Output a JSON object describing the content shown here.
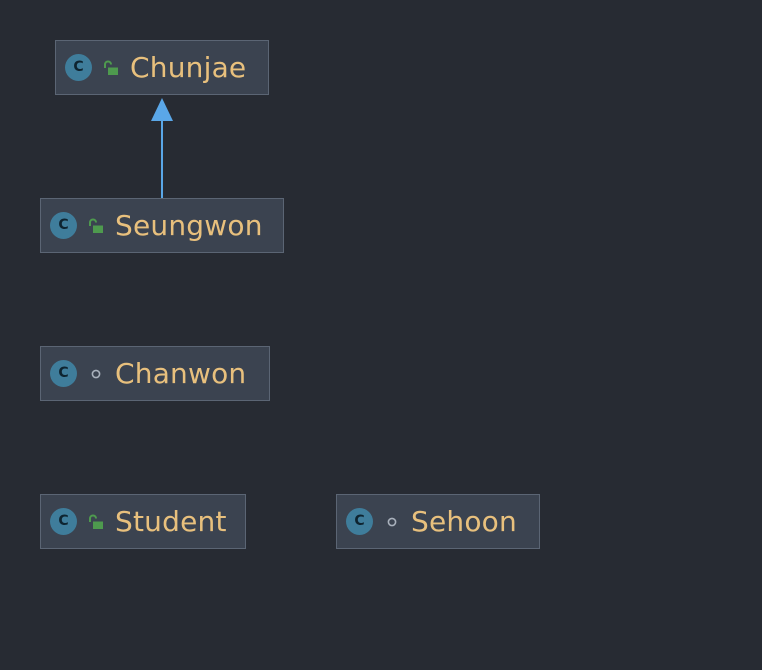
{
  "diagram": {
    "classes": [
      {
        "id": "chunjae",
        "kind_icon": "class-icon",
        "kind_letter": "C",
        "visibility_icon": "public-lock-icon",
        "name": "Chunjae"
      },
      {
        "id": "seungwon",
        "kind_icon": "class-icon",
        "kind_letter": "C",
        "visibility_icon": "public-lock-icon",
        "name": "Seungwon"
      },
      {
        "id": "chanwon",
        "kind_icon": "class-icon",
        "kind_letter": "C",
        "visibility_icon": "package-private-dot-icon",
        "name": "Chanwon"
      },
      {
        "id": "student",
        "kind_icon": "class-icon",
        "kind_letter": "C",
        "visibility_icon": "public-lock-icon",
        "name": "Student"
      },
      {
        "id": "sehoon",
        "kind_icon": "class-icon",
        "kind_letter": "C",
        "visibility_icon": "package-private-dot-icon",
        "name": "Sehoon"
      }
    ],
    "relations": [
      {
        "type": "extends",
        "from": "seungwon",
        "to": "chunjae"
      }
    ],
    "colors": {
      "background": "#272b33",
      "node_fill": "#3b4350",
      "node_border": "#5b6574",
      "class_icon": "#3f7d9b",
      "public_icon": "#4e9a4e",
      "class_name_text": "#e8c07d",
      "inheritance_arrow": "#5aa7e8"
    }
  }
}
